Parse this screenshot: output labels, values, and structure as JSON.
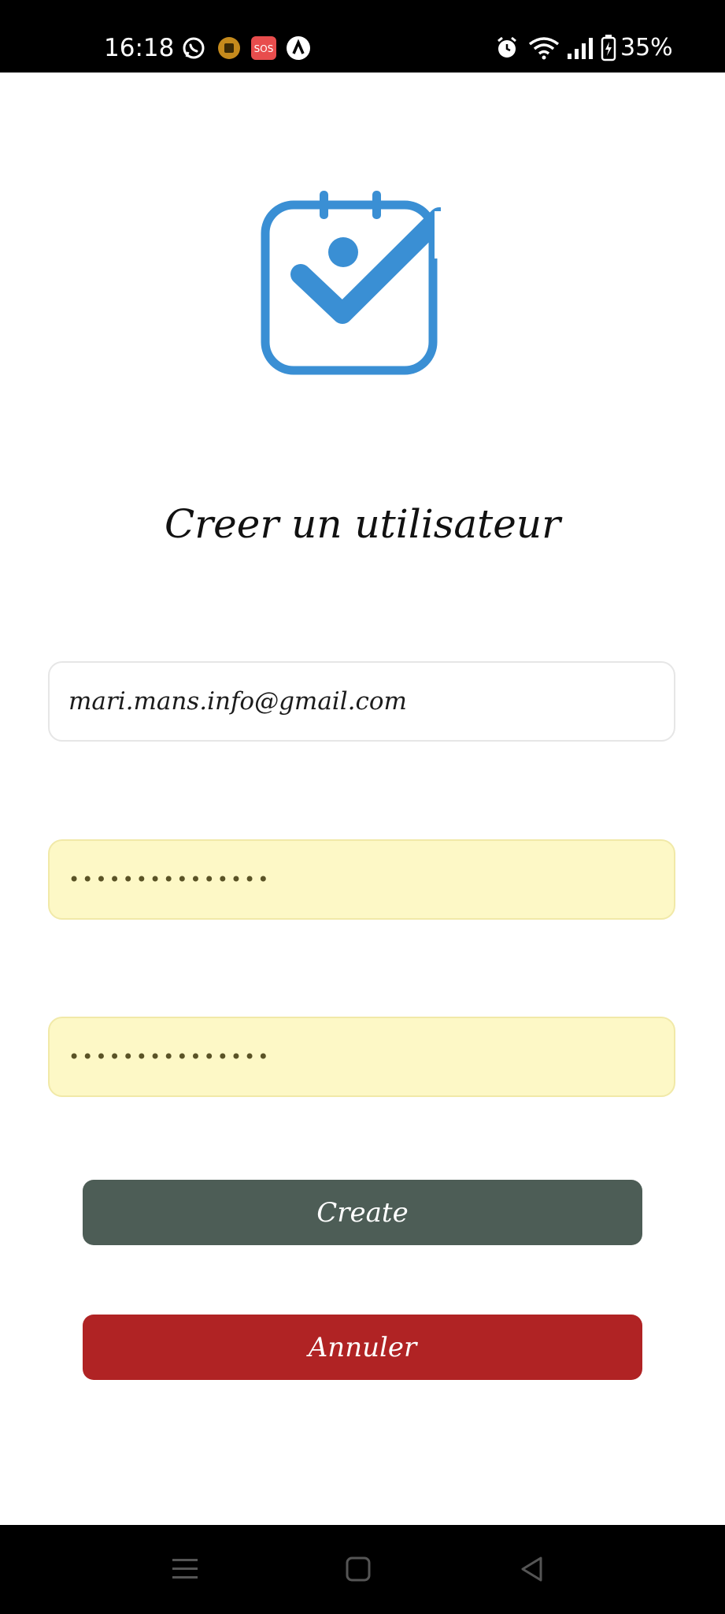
{
  "status_bar": {
    "time": "16:18",
    "notification_icons": [
      "whatsapp-icon",
      "app-icon",
      "sos-icon",
      "app-a-icon"
    ],
    "sos_label": "SOS",
    "system_icons": [
      "alarm-icon",
      "wifi-icon",
      "signal-icon",
      "battery-icon"
    ],
    "battery_percent": "35%"
  },
  "page": {
    "logo_icon": "calendar-check-icon",
    "title": "Creer un utilisateur"
  },
  "form": {
    "email_value": "mari.mans.info@gmail.com",
    "password_value": "•••••••••••••••",
    "confirm_password_value": "•••••••••••••••"
  },
  "buttons": {
    "create_label": "Create",
    "cancel_label": "Annuler"
  },
  "colors": {
    "accent_blue": "#3a8fd4",
    "create_button": "#4d5d56",
    "cancel_button": "#b02324",
    "autofill_background": "#fdf8c6"
  },
  "nav_bar": {
    "icons": [
      "recent-apps-icon",
      "home-icon",
      "back-icon"
    ]
  }
}
